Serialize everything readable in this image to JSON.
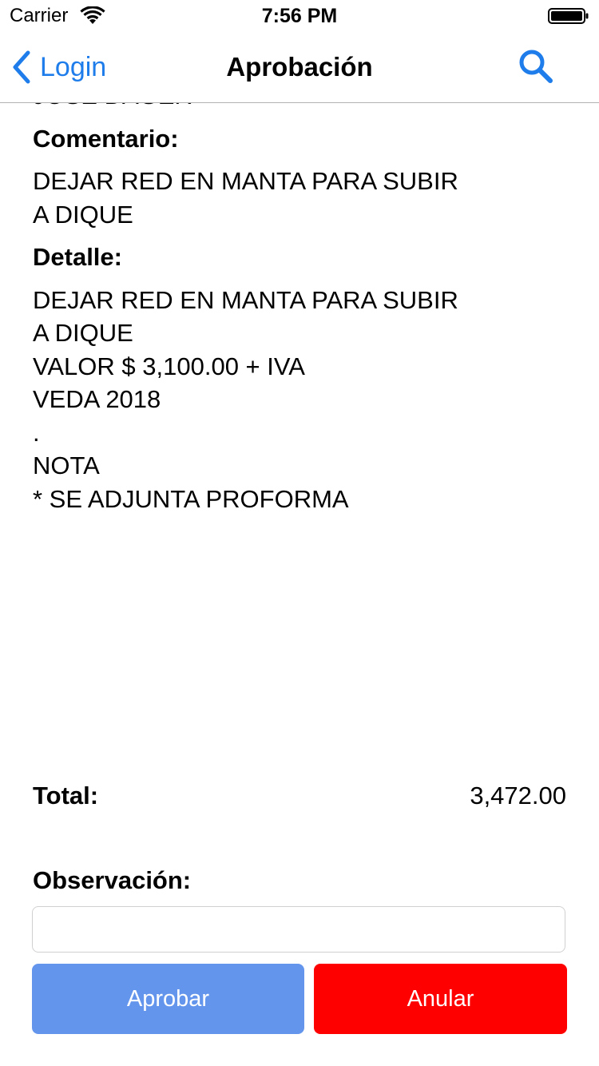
{
  "status_bar": {
    "carrier": "Carrier",
    "time": "7:56 PM"
  },
  "nav": {
    "back_label": "Login",
    "title": "Aprobación",
    "accent_color": "#1e7dea"
  },
  "content": {
    "name_partial": "JOSE  DAGER",
    "comment_label": "Comentario:",
    "comment_text": "DEJAR RED EN MANTA PARA SUBIR\nA DIQUE",
    "detail_label": "Detalle:",
    "detail_lines": [
      "DEJAR RED EN MANTA PARA SUBIR",
      "A DIQUE",
      "VALOR $  3,100.00 + IVA",
      "VEDA 2018",
      ".",
      "NOTA",
      "* SE ADJUNTA PROFORMA"
    ]
  },
  "total": {
    "label": "Total:",
    "value": "3,472.00"
  },
  "observation": {
    "label": "Observación:",
    "value": "",
    "placeholder": ""
  },
  "actions": {
    "approve_label": "Aprobar",
    "approve_color": "#6495ed",
    "cancel_label": "Anular",
    "cancel_color": "#ff0000"
  }
}
